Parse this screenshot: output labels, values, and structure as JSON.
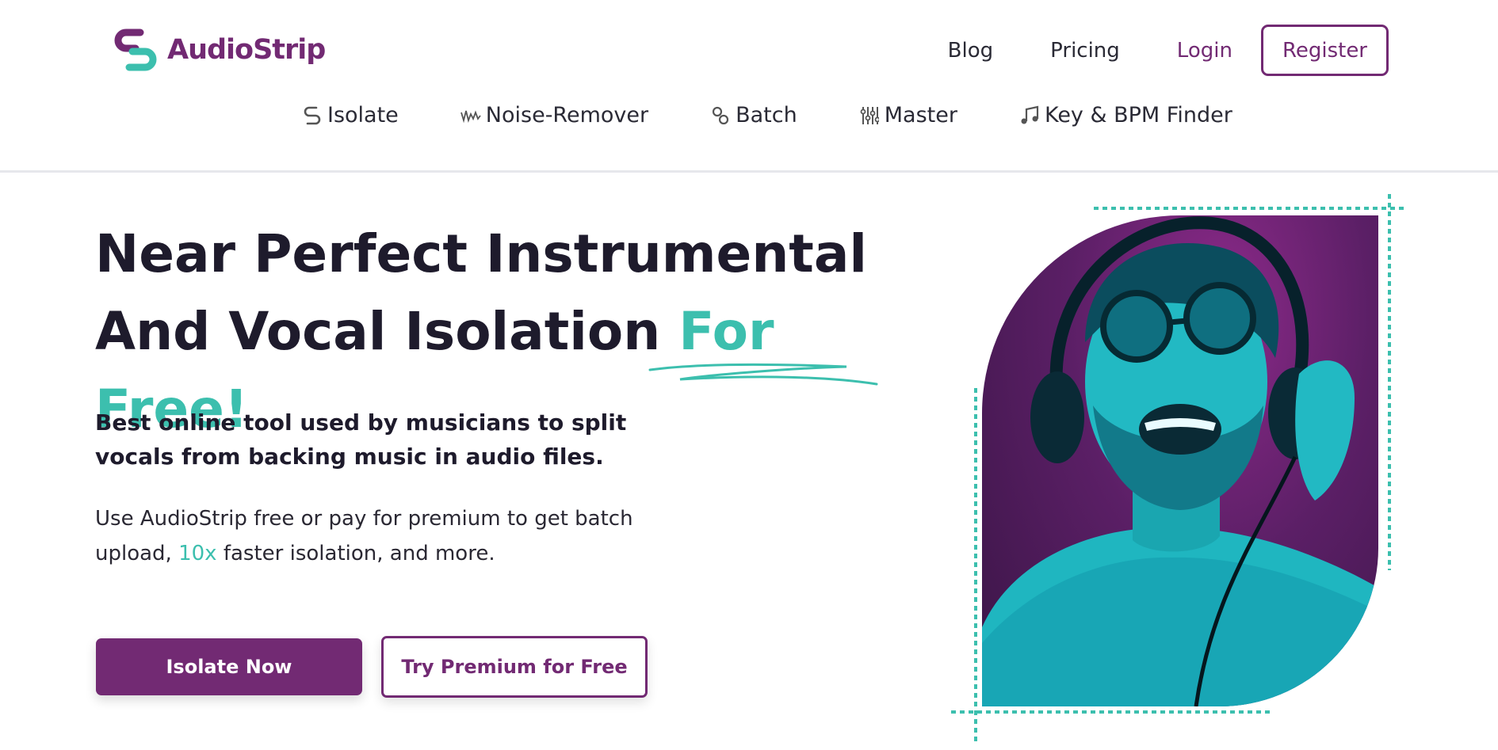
{
  "brand": {
    "name": "AudioStrip",
    "primary": "#722a73",
    "accent": "#3cbfae"
  },
  "topnav": {
    "blog": "Blog",
    "pricing": "Pricing",
    "login": "Login",
    "register": "Register"
  },
  "tools": [
    {
      "label": "Isolate",
      "icon": "isolate-icon"
    },
    {
      "label": "Noise-Remover",
      "icon": "noise-wave-icon"
    },
    {
      "label": "Batch",
      "icon": "batch-link-icon"
    },
    {
      "label": "Master",
      "icon": "master-levels-icon"
    },
    {
      "label": "Key & BPM Finder",
      "icon": "music-note-icon"
    }
  ],
  "hero": {
    "title_line1": "Near Perfect Instrumental",
    "title_line2": "And Vocal Isolation ",
    "title_accent": "For Free!",
    "subhead": "Best online tool used by musicians to split vocals from backing music in audio files.",
    "body_part1": "Use AudioStrip free or pay for premium to get batch upload, ",
    "body_highlight": "10x",
    "body_part2": " faster isolation, and more.",
    "cta_primary": "Isolate Now",
    "cta_secondary": "Try Premium for Free"
  }
}
